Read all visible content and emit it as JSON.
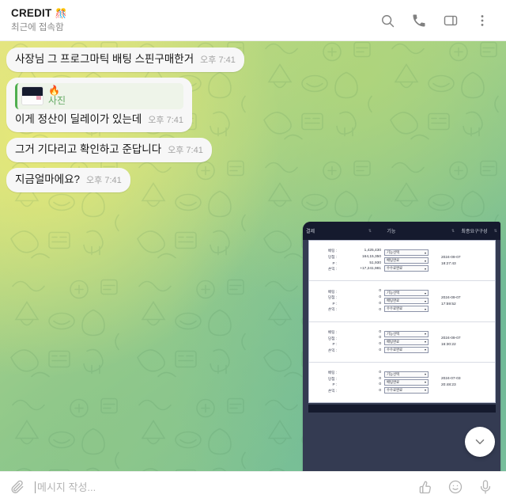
{
  "header": {
    "title": "CREDIT",
    "title_emoji": "🎊",
    "subtitle": "최근에 접속함",
    "actions": [
      {
        "name": "search-icon",
        "label": "검색"
      },
      {
        "name": "call-icon",
        "label": "통화"
      },
      {
        "name": "sidebar-panel-icon",
        "label": "패널"
      },
      {
        "name": "more-vertical-icon",
        "label": "더보기"
      }
    ]
  },
  "messages": [
    {
      "id": "msg-1",
      "text": "사장님 그 프로그마틱 배팅 스핀구매한거",
      "time": "오후 7:41",
      "has_reply": false
    },
    {
      "id": "msg-2",
      "text": "이게 정산이 딜레이가 있는데",
      "time": "오후 7:41",
      "has_reply": true,
      "reply": {
        "sender": "🔥",
        "preview_label": "사진",
        "thumb": "table-screenshot-thumbnail"
      }
    },
    {
      "id": "msg-3",
      "text": "그거 기다리고 확인하고 준답니다",
      "time": "오후 7:41",
      "has_reply": false
    },
    {
      "id": "msg-4",
      "text": "지금얼마에요?",
      "time": "오후 7:41",
      "has_reply": false
    }
  ],
  "photo_message": {
    "name": "attached-screenshot",
    "topbar": {
      "col1": "결제",
      "col2": "기능",
      "col3": "최종요구구성"
    },
    "table": {
      "row_labels": [
        "배팅 :",
        "당첨 :",
        "P :",
        "손익 :"
      ],
      "select_labels": [
        "기능선택",
        "배팅완료",
        "수수료완료"
      ],
      "rows": [
        {
          "values": [
            "1,425,430",
            "164,15,350",
            "51,930",
            "+17,241,981"
          ],
          "date": "2024-09-07",
          "time": "18:27:43"
        },
        {
          "values": [
            "0",
            "0",
            "0",
            "0"
          ],
          "date": "2024-09-07",
          "time": "17:59:52"
        },
        {
          "values": [
            "0",
            "0",
            "0",
            "0"
          ],
          "date": "2024-09-07",
          "time": "16:30:22"
        },
        {
          "values": [
            "0",
            "0",
            "0",
            "0"
          ],
          "date": "2024-07-03",
          "time": "20:48:23"
        }
      ]
    }
  },
  "scroll_down": {
    "name": "scroll-to-bottom-button",
    "icon": "chevron-down-icon"
  },
  "composer": {
    "attach_icon": "paperclip-icon",
    "placeholder": "메시지 작성...",
    "value": "",
    "actions": [
      {
        "name": "sticker-thumbsup-icon",
        "label": "스티커"
      },
      {
        "name": "emoji-smile-icon",
        "label": "이모티콘"
      },
      {
        "name": "microphone-icon",
        "label": "음성메시지"
      }
    ]
  },
  "colors": {
    "bubble_bg": "#f7f7f7",
    "accent_green": "#4fae4f",
    "wallpaper_from": "#dfe08a",
    "wallpaper_to": "#7fc4a0",
    "screenshot_dark": "#151a2e"
  }
}
